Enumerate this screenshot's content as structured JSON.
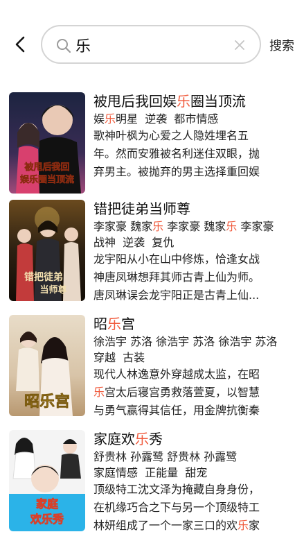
{
  "search": {
    "query": "乐",
    "button_label": "搜索",
    "highlight_color": "#f05a3c"
  },
  "results": [
    {
      "title_pre": "被甩后我回娱",
      "title_hl": "乐",
      "title_post": "圈当顶流",
      "tags_line1_pre": "娱",
      "tags_line1_hl": "乐",
      "tags_line1_post": "明星  逆袭  都市情感",
      "desc": [
        "歌神叶枫为心爱之人隐姓埋名五",
        "年。然而安雅被名利迷住双眼，抛",
        "弃男主。被抛弃的男主选择重回娱"
      ],
      "cover_text_1": "被甩后我回",
      "cover_text_2": "娱乐圈当顶流"
    },
    {
      "title_pre": "错把徒弟当师尊",
      "title_hl": "",
      "title_post": "",
      "tags_actors": [
        {
          "pre": "李家豪 魏家",
          "hl": "乐",
          "post": " "
        },
        {
          "pre": "李家豪 魏家",
          "hl": "乐",
          "post": " "
        },
        {
          "pre": "李家豪",
          "hl": "",
          "post": ""
        }
      ],
      "tags_line2": "战神  逆袭  复仇",
      "desc": [
        "龙宇阳从小在山中修炼，恰逢女战",
        "神唐凤琳想拜其师古青上仙为师。",
        "唐凤琳误会龙宇阳正是古青上仙..."
      ],
      "cover_text_1": "错把徒弟",
      "cover_text_2": "当师尊"
    },
    {
      "title_pre": "昭",
      "title_hl": "乐",
      "title_post": "宫",
      "tags_line1_plain": "徐浩宇 苏洛 徐浩宇 苏洛 徐浩宇 苏洛",
      "tags_line2": "穿越  古装",
      "desc_line1": "现代人林逸意外穿越成太监，在昭",
      "desc_line2_hl": "乐",
      "desc_line2_post": "宫太后寝宫勇救落萱夏，以智慧",
      "desc_line3": "与勇气赢得其信任，用金牌抗衡秦",
      "cover_text_1": "昭乐宫"
    },
    {
      "title_pre": "家庭欢",
      "title_hl": "乐",
      "title_post": "秀",
      "tags_line1_plain": "舒贵林 孙露鹭 舒贵林 孙露鹭",
      "tags_line2": "家庭情感  正能量  甜宠",
      "desc": [
        "顶级特工沈文泽为掩藏自身身份，",
        "在机缘巧合之下与另一个顶级特工"
      ],
      "desc_line3_pre": "林妍组成了一个一家三口的欢",
      "desc_line3_hl": "乐",
      "desc_line3_post": "家",
      "cover_text_1": "家庭",
      "cover_text_2": "欢乐秀"
    }
  ]
}
